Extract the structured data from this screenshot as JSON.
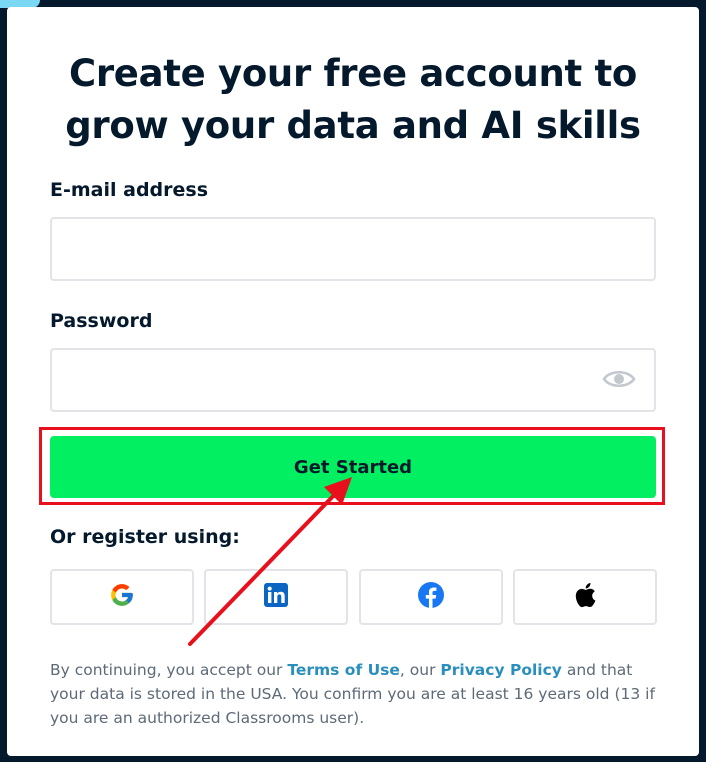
{
  "form": {
    "title_line1": "Create your free account to",
    "title_line2": "grow your data and AI skills",
    "email_label": "E-mail address",
    "email_value": "",
    "email_placeholder": "",
    "password_label": "Password",
    "password_value": "",
    "password_placeholder": "",
    "submit_label": "Get Started"
  },
  "social": {
    "heading": "Or register using:",
    "providers": [
      {
        "name": "Google",
        "icon": "google-icon"
      },
      {
        "name": "LinkedIn",
        "icon": "linkedin-icon"
      },
      {
        "name": "Facebook",
        "icon": "facebook-icon"
      },
      {
        "name": "Apple",
        "icon": "apple-icon"
      }
    ]
  },
  "legal": {
    "part1": "By continuing, you accept our ",
    "terms_link": "Terms of Use",
    "part2": ", our ",
    "privacy_link": "Privacy Policy",
    "part3": " and that your data is stored in the USA. You confirm you are at least 16 years old (13 if you are an authorized Classrooms user)."
  },
  "colors": {
    "background": "#05192d",
    "primary": "#03ef62",
    "link": "#2a8fbd",
    "highlight": "#e8101c"
  }
}
